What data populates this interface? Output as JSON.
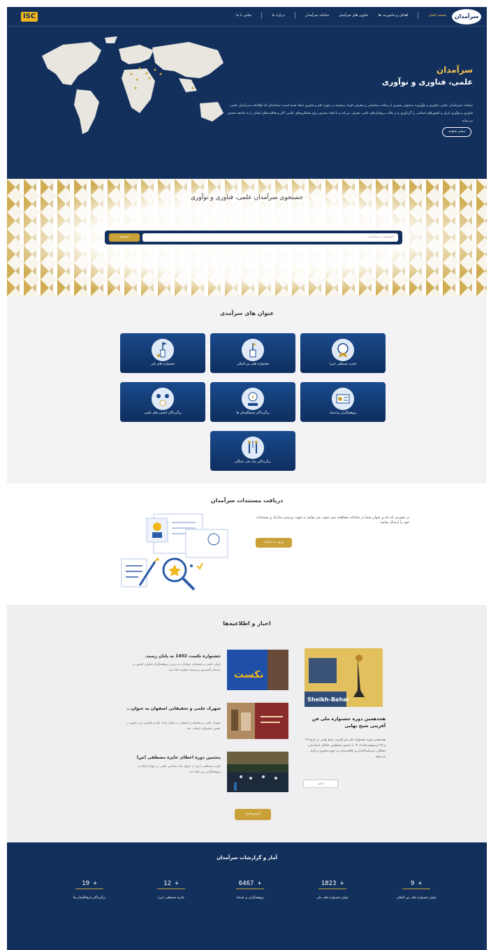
{
  "navbar": {
    "logo_left": "ISC",
    "logo_right": "سرآمدان",
    "items": [
      "صفحه اصلی",
      "اهداف و ماموریت ها",
      "عناوین های سرآمدی",
      "سامانه سرآمدان",
      "درباره ما",
      "تماس با ما"
    ]
  },
  "hero": {
    "title_line1": "سرآمدان",
    "title_line2": "علمی، فناوری و نوآوری",
    "description": "سامانه «سرآمدان علمی، فناوری و نوآوری» به‌عنوان بستری با رسالت شناسایی و معرفی افراد برجسته در حوزه علم و فناوری ایجاد شده است؛ سامانه‌ای که اطلاعات سرآمدان علمی، فناوری و نوآوری ایران و کشورهای اسلامی را گردآوری و در قالب پروفایل‌های علمی معرفی می‌کند و با ایجاد بستری برای همکاری‌های علمی، آثار و فعالیت‌های ایشان را به جامعه معرفی می‌نماید.",
    "more_button": "بیشتر بخوانید"
  },
  "search": {
    "title": "جستجوی سرآمدان علمی، فناوری و نوآوری",
    "placeholder": "جستجو در سرآمدان...",
    "button": "جستجو"
  },
  "titles": {
    "heading": "عنوان های سرآمدی",
    "cards": [
      {
        "label": "جایزه مصطفی (ص)"
      },
      {
        "label": "جشنواره های بین المللی"
      },
      {
        "label": "جشنواره های ملی"
      },
      {
        "label": "پژوهشگران پراستناد"
      },
      {
        "label": "برگزیدگان فرهنگستان ها"
      },
      {
        "label": "برگزیدگان انجمن های علمی"
      },
      {
        "label": "برگزیدگان بنیاد ملی نخبگان"
      }
    ]
  },
  "certificates": {
    "heading": "دریافت مستندات سرآمدان",
    "text": "در صورتی که نام و عنوان شما در سامانه مشاهده نمی شود، می توانید به جهت بررسی مدارک و مستندات خود را ارسال نمایید.",
    "button": "ورود به سامانه"
  },
  "news": {
    "heading": "اخبار و اطلاعیه‌ها",
    "main": {
      "image_caption": "Sheikh-Bahai",
      "title": "هجدهمین دوره جشنواره ملی فن آفرینی شیخ بهایی",
      "text": "هجدهمین دوره جشنواره ملی فن آفرینی شیخ بهایی در تاریخ ۲۶ و ۲۷ اردیبهشت‌ماه ۱۴۰۳ با حضور مسئولین، فعالان استارتاپی، نخبگان، سرمایه‌گذاران و علاقه‌مندان به حوزه فناوری برگزار می‌شود.",
      "more": "ادامه"
    },
    "items": [
      {
        "title": "جشنواره نکست 1402 به پایان رسید.",
        "text": "جوایز علمی و تحقیقاتی جهانیان به برترین پژوهشگران فناوری کشور در راستای گسترش و توسعه فناوری اهدا شد.",
        "image_label": "نکست"
      },
      {
        "title": "شهرک علمی و تحقیقاتی اصفهان به عنوان...",
        "text": "شهرک علمی و تحقیقاتی اصفهان به عنوان پارک علم و فناوری برتر کشور در دهمین جشنواره انتخاب شد."
      },
      {
        "title": "پنجمین دوره اعطای جایزه مصطفی (ص)",
        "text": "جایزه مصطفی (ص) به عنوان نماد شاخص علمی در جهان اسلام به پژوهشگران برتر اهدا شد."
      }
    ],
    "archive_button": "آرشیو اخبار"
  },
  "stats": {
    "heading": "آمار و گزارشات سرآمدان",
    "items": [
      {
        "value": "9 +",
        "label": "جوایز جشنواره های بین المللی"
      },
      {
        "value": "1823 +",
        "label": "جوایز جشنواره های ملی"
      },
      {
        "value": "6467 +",
        "label": "پژوهشگران پر استناد"
      },
      {
        "value": "12 +",
        "label": "جایزه مصطفی (ص)"
      },
      {
        "value": "19 +",
        "label": "برگزیدگان فرهنگستان ها"
      }
    ]
  },
  "colors": {
    "navy": "#13305d",
    "gold": "#c9a138",
    "gold_light": "#f2c34d"
  }
}
